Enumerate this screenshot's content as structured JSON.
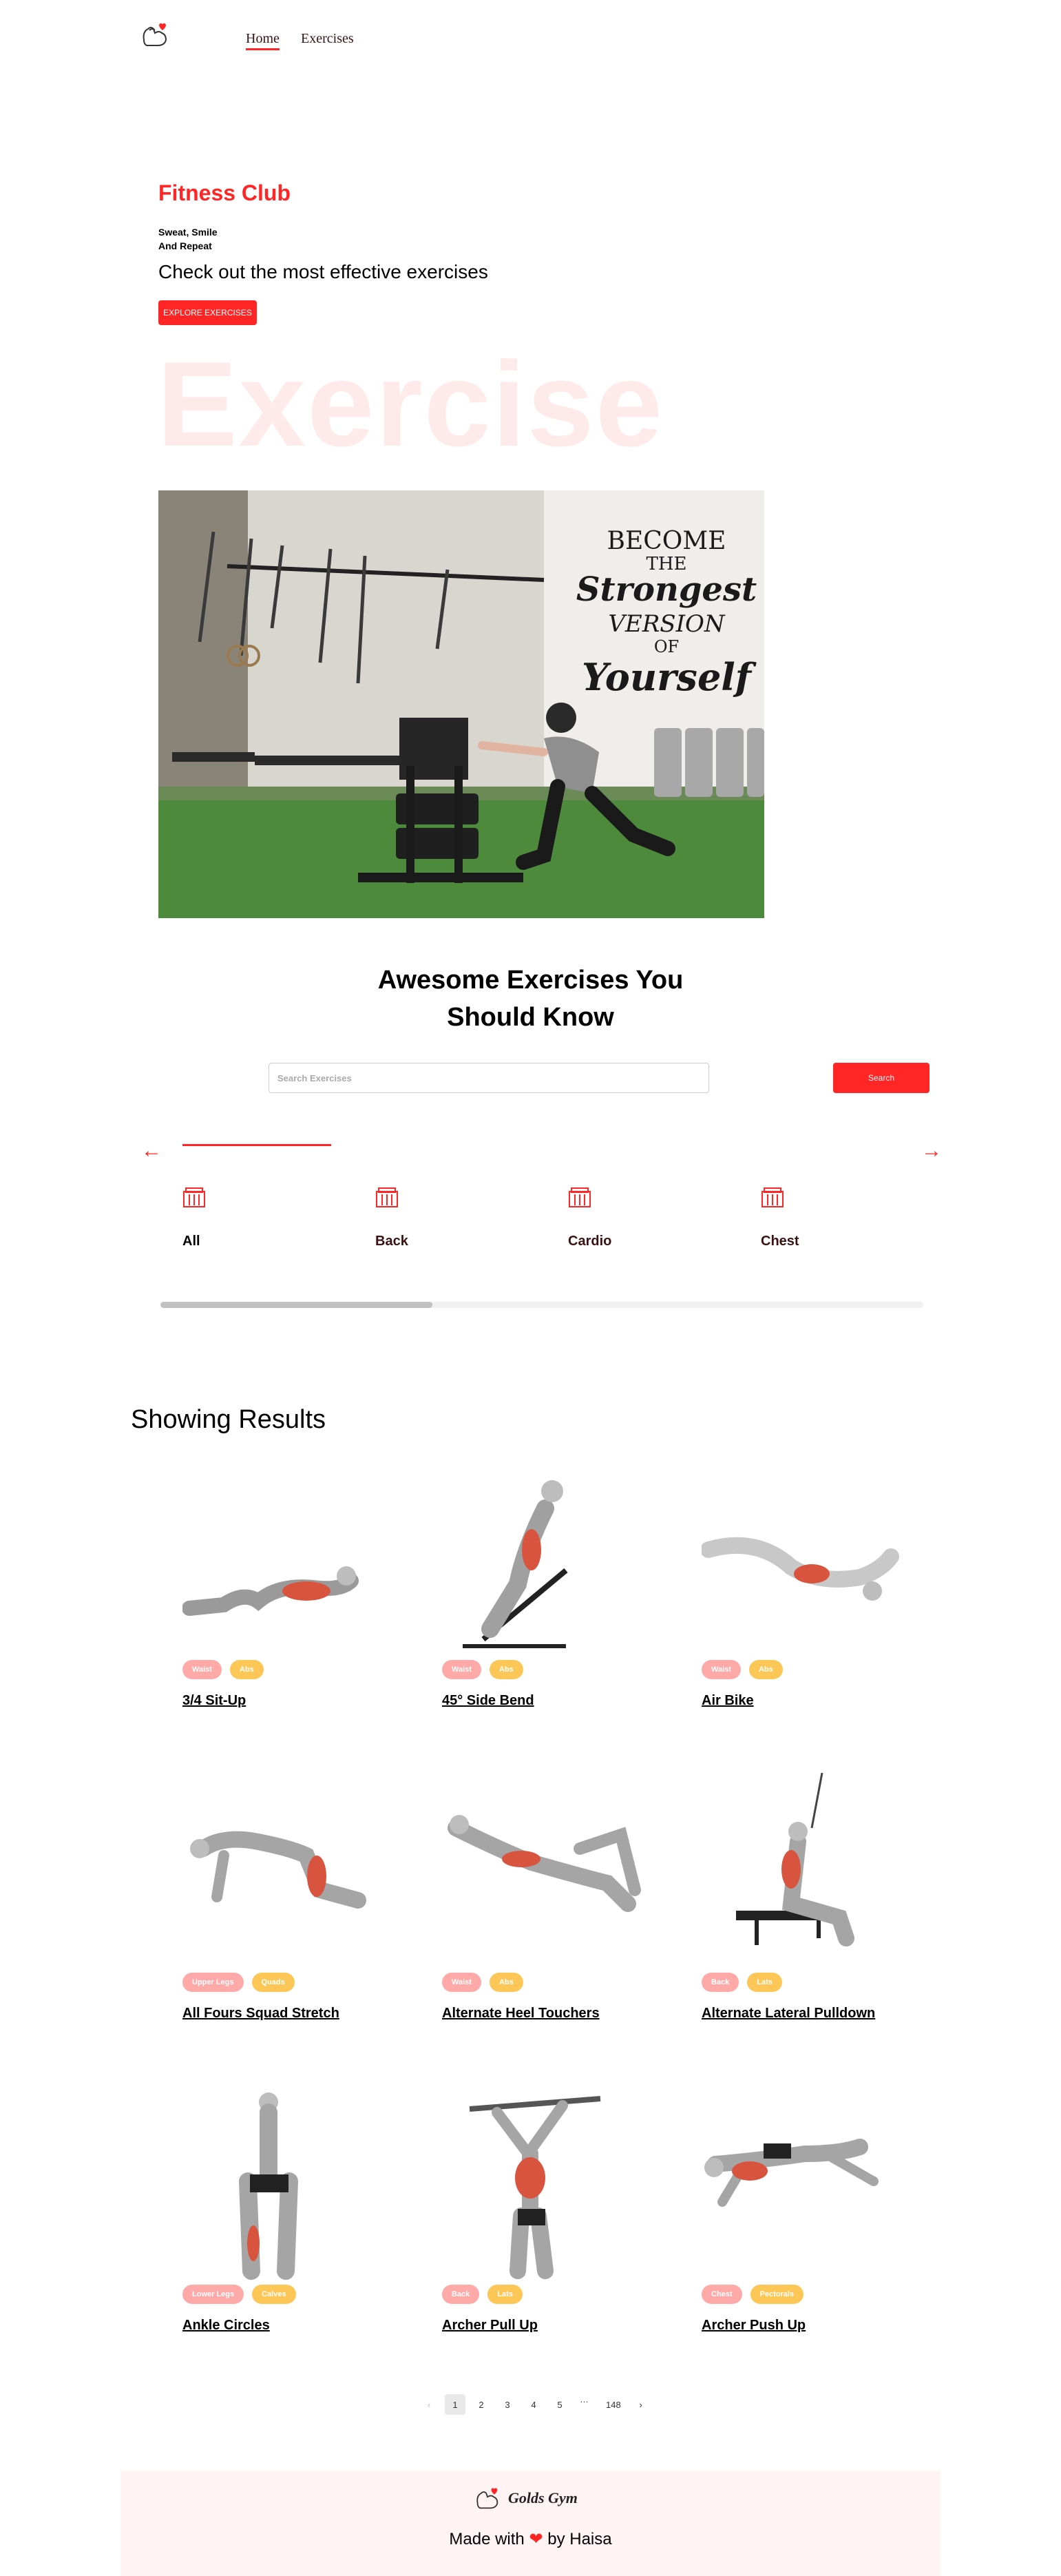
{
  "nav": {
    "home": "Home",
    "exercises": "Exercises"
  },
  "hero": {
    "title": "Fitness Club",
    "subtitle_line1": "Sweat, Smile",
    "subtitle_line2": "And Repeat",
    "text": "Check out the most effective exercises",
    "button": "EXPLORE EXERCISES",
    "bg_word": "Exercise",
    "banner_wall_text": [
      "BECOME",
      "THE",
      "Strongest",
      "VERSION",
      "OF",
      "Yourself"
    ]
  },
  "search": {
    "title_line1": "Awesome Exercises You",
    "title_line2": "Should Know",
    "placeholder": "Search Exercises",
    "button": "Search"
  },
  "categories": {
    "arrow_left": "←",
    "arrow_right": "→",
    "items": [
      {
        "label": "All",
        "icon": "gym-icon"
      },
      {
        "label": "Back",
        "icon": "gym-icon"
      },
      {
        "label": "Cardio",
        "icon": "gym-icon"
      },
      {
        "label": "Chest",
        "icon": "gym-icon"
      }
    ]
  },
  "results": {
    "title": "Showing Results",
    "cards": [
      {
        "name": "3/4 Sit-Up",
        "body_part": "Waist",
        "target": "Abs"
      },
      {
        "name": "45° Side Bend",
        "body_part": "Waist",
        "target": "Abs"
      },
      {
        "name": "Air Bike",
        "body_part": "Waist",
        "target": "Abs"
      },
      {
        "name": "All Fours Squad Stretch",
        "body_part": "Upper Legs",
        "target": "Quads"
      },
      {
        "name": "Alternate Heel Touchers",
        "body_part": "Waist",
        "target": "Abs"
      },
      {
        "name": "Alternate Lateral Pulldown",
        "body_part": "Back",
        "target": "Lats"
      },
      {
        "name": "Ankle Circles",
        "body_part": "Lower Legs",
        "target": "Calves"
      },
      {
        "name": "Archer Pull Up",
        "body_part": "Back",
        "target": "Lats"
      },
      {
        "name": "Archer Push Up",
        "body_part": "Chest",
        "target": "Pectorals"
      }
    ]
  },
  "pagination": {
    "prev": "‹",
    "pages": [
      "1",
      "2",
      "3",
      "4",
      "5",
      "…",
      "148"
    ],
    "next": "›",
    "current": "1"
  },
  "footer": {
    "brand": "Golds Gym",
    "made_prefix": "Made with",
    "heart": "❤",
    "made_suffix": "by Haisa"
  },
  "colors": {
    "accent": "#ff2625",
    "tag_body": "#ffa9a9",
    "tag_target": "#fcc757",
    "footer_bg": "#fff3f4"
  }
}
